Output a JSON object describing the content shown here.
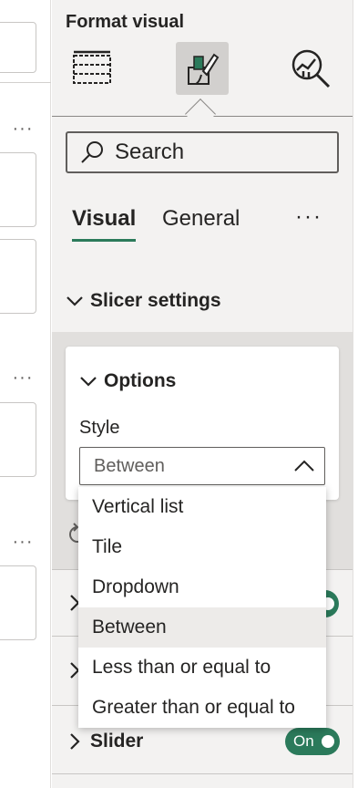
{
  "left_panel": {
    "more_label": "···"
  },
  "pane": {
    "title": "Format visual",
    "icons": {
      "build": "table-grid-icon",
      "format": "paintbrush-icon",
      "analytics": "magnifier-chart-icon"
    },
    "search": {
      "placeholder": "Search"
    },
    "tabs": [
      {
        "label": "Visual",
        "selected": true
      },
      {
        "label": "General",
        "selected": false
      }
    ],
    "more_label": "···",
    "sections": {
      "slicer_settings": {
        "label": "Slicer settings",
        "options": {
          "label": "Options",
          "style_label": "Style",
          "style_value": "Between"
        }
      },
      "slider": {
        "label": "Slider",
        "toggle": "On"
      }
    },
    "dropdown": {
      "items": [
        "Vertical list",
        "Tile",
        "Dropdown",
        "Between",
        "Less than or equal to",
        "Greater than or equal to"
      ],
      "selected_index": 3
    }
  },
  "colors": {
    "accent": "#2b7a5b",
    "pane_bg": "#f3f2f1"
  }
}
